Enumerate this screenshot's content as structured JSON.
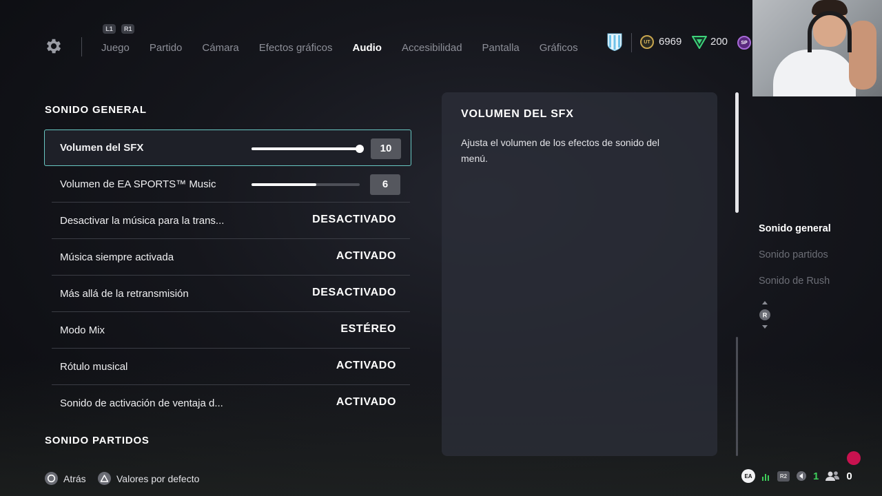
{
  "nav": {
    "shoulder_left": "L1",
    "shoulder_right": "R1",
    "tabs": [
      {
        "label": "Juego",
        "active": false
      },
      {
        "label": "Partido",
        "active": false
      },
      {
        "label": "Cámara",
        "active": false
      },
      {
        "label": "Efectos gráficos",
        "active": false
      },
      {
        "label": "Audio",
        "active": true
      },
      {
        "label": "Accesibilidad",
        "active": false
      },
      {
        "label": "Pantalla",
        "active": false
      },
      {
        "label": "Gráficos",
        "active": false
      }
    ],
    "coins_icon_text": "UT",
    "coins": "6969",
    "points": "200",
    "sp_icon_text": "SP"
  },
  "sections": {
    "general_title": "SONIDO GENERAL",
    "partidos_title": "SONIDO PARTIDOS"
  },
  "settings": [
    {
      "label": "Volumen del SFX",
      "type": "slider",
      "value": "10",
      "level": 1.0
    },
    {
      "label": "Volumen de EA SPORTS™ Music",
      "type": "slider",
      "value": "6",
      "level": 0.6
    },
    {
      "label": "Desactivar la música para la trans...",
      "type": "toggle",
      "value": "DESACTIVADO"
    },
    {
      "label": "Música siempre activada",
      "type": "toggle",
      "value": "ACTIVADO"
    },
    {
      "label": "Más allá de la retransmisión",
      "type": "toggle",
      "value": "DESACTIVADO"
    },
    {
      "label": "Modo Mix",
      "type": "select",
      "value": "ESTÉREO"
    },
    {
      "label": "Rótulo musical",
      "type": "toggle",
      "value": "ACTIVADO"
    },
    {
      "label": "Sonido de activación de ventaja d...",
      "type": "toggle",
      "value": "ACTIVADO"
    }
  ],
  "description": {
    "title": "VOLUMEN DEL SFX",
    "text": "Ajusta el volumen de los efectos de sonido del menú."
  },
  "section_nav": [
    {
      "label": "Sonido general",
      "active": true
    },
    {
      "label": "Sonido partidos",
      "active": false
    },
    {
      "label": "Sonido de Rush",
      "active": false
    }
  ],
  "rstick_label": "R",
  "footer": {
    "back_label": "Atrás",
    "defaults_label": "Valores por defecto"
  },
  "tray": {
    "ea_label": "EA",
    "r2_label": "R2",
    "party_count": "1",
    "friends_count": "0"
  },
  "colors": {
    "focus_border": "#69c9c4",
    "rec_dot": "#c8124f",
    "online_green": "#3ecf5a"
  }
}
